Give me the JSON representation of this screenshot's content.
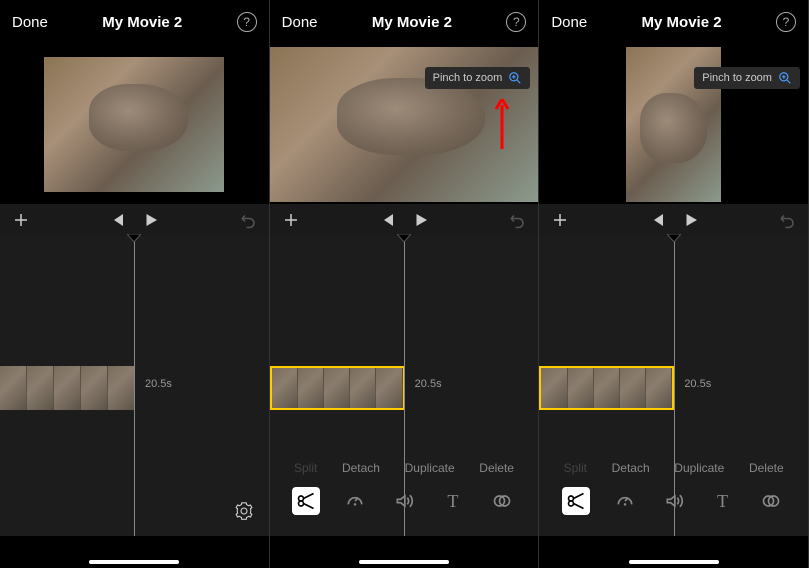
{
  "header": {
    "done": "Done",
    "title": "My Movie 2",
    "help": "?"
  },
  "tooltip": {
    "label": "Pinch to zoom"
  },
  "timeline": {
    "duration": "20.5s"
  },
  "actions": {
    "split": "Split",
    "detach": "Detach",
    "duplicate": "Duplicate",
    "delete": "Delete"
  },
  "icons": {
    "add": "plus",
    "skip_back": "skip-to-start",
    "play": "play",
    "undo": "undo",
    "gear": "settings",
    "scissors": "cut",
    "speed": "speedometer",
    "volume": "audio",
    "text": "T",
    "filters": "overlap-circles",
    "zoom": "magnifier-plus"
  }
}
